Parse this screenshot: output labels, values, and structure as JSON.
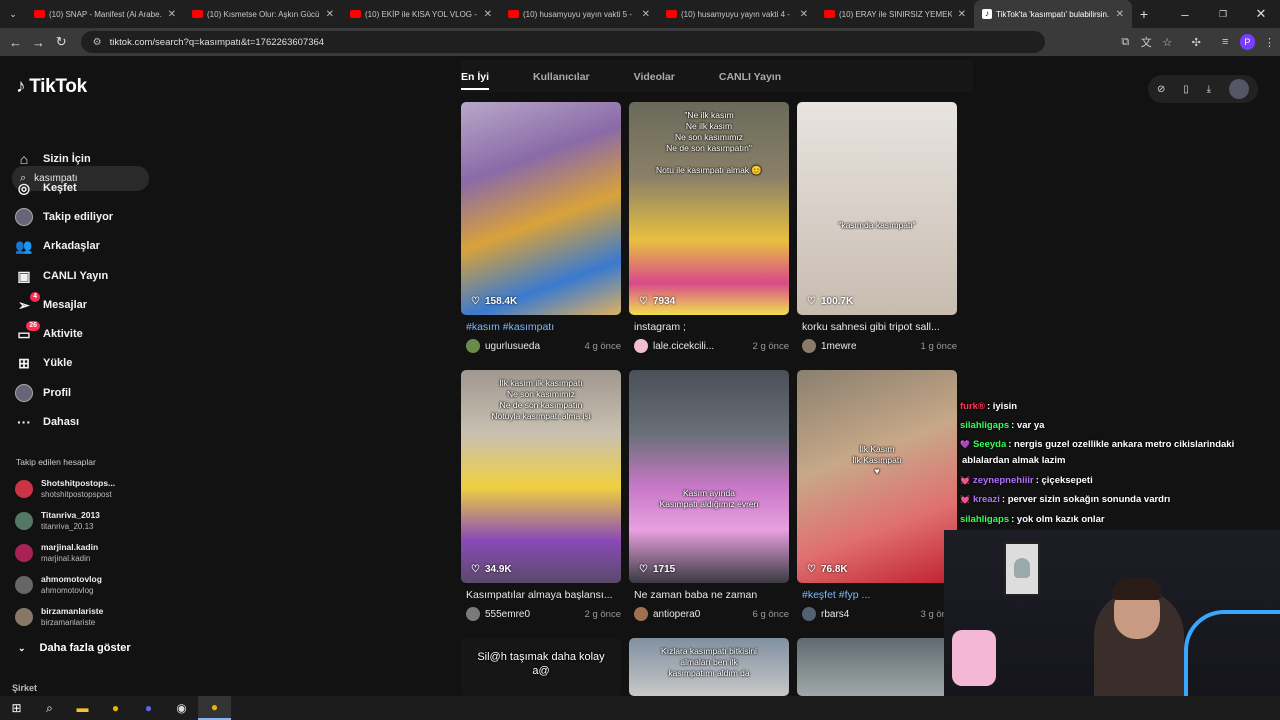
{
  "browser": {
    "tabs": [
      {
        "label": "(10) SNAP - Manifest (Ai Arabe...",
        "icon": "youtube-icon",
        "active": false
      },
      {
        "label": "(10) Kısmetse Olur: Aşkın Gücü...",
        "icon": "youtube-icon",
        "active": false
      },
      {
        "label": "(10) EKİP ile KISA YOL VLOG - T...",
        "icon": "youtube-icon",
        "active": false
      },
      {
        "label": "(10) husamyuyu yayın vakti 5 -",
        "icon": "youtube-icon",
        "active": false
      },
      {
        "label": "(10) husamyuyu yayın vakti 4 -",
        "icon": "youtube-icon",
        "active": false
      },
      {
        "label": "(10) ERAY ile SINIRSIZ YEMEK T...",
        "icon": "youtube-icon",
        "active": false
      },
      {
        "label": "TikTok'ta 'kasımpatı' bulabilirsin...",
        "icon": "tiktok-icon",
        "active": true
      }
    ],
    "new_tab": "+",
    "url": "tiktok.com/search?q=kasımpatı&t=1762263607364",
    "profile_initial": "P"
  },
  "sidebar": {
    "logo": "TikTok",
    "search_value": "kasımpatı",
    "menu": [
      {
        "label": "Sizin İçin",
        "icon": "home-icon",
        "glyph": "⌂"
      },
      {
        "label": "Keşfet",
        "icon": "compass-icon",
        "glyph": "◎"
      },
      {
        "label": "Takip ediliyor",
        "icon": "following-avatar-icon",
        "glyph": ""
      },
      {
        "label": "Arkadaşlar",
        "icon": "friends-icon",
        "glyph": "👥"
      },
      {
        "label": "CANLI Yayın",
        "icon": "live-icon",
        "glyph": "▣"
      },
      {
        "label": "Mesajlar",
        "icon": "messages-icon",
        "glyph": "➢",
        "badge": "4"
      },
      {
        "label": "Aktivite",
        "icon": "activity-icon",
        "glyph": "▭",
        "badge": "26"
      },
      {
        "label": "Yükle",
        "icon": "upload-icon",
        "glyph": "⊞"
      },
      {
        "label": "Profil",
        "icon": "profile-avatar-icon",
        "glyph": ""
      },
      {
        "label": "Dahası",
        "icon": "more-icon",
        "glyph": "···"
      }
    ],
    "followed_title": "Takip edilen hesaplar",
    "followed": [
      {
        "name": "Shotshitpostops...",
        "handle": "shotshitpostopspost",
        "color": "#cc3344"
      },
      {
        "name": "Titanriva_2013",
        "handle": "titanriva_20.13",
        "color": "#557766"
      },
      {
        "name": "marjinal.kadin",
        "handle": "marjinal.kadin",
        "color": "#aa2255"
      },
      {
        "name": "ahmomotovlog",
        "handle": "ahmomotovlog",
        "color": "#666666"
      },
      {
        "name": "birzamanlariste",
        "handle": "birzamanlariste",
        "color": "#887766"
      }
    ],
    "show_more": "Daha fazla göster",
    "company": "Şirket"
  },
  "search_tabs": [
    "En İyi",
    "Kullanıcılar",
    "Videolar",
    "CANLI Yayın"
  ],
  "results": [
    {
      "likes": "158.4K",
      "desc": "#kasım #kasımpatı",
      "desc_is_tag": true,
      "user": "ugurlusueda",
      "time": "4 g önce",
      "overlay": "",
      "bg": "linear-gradient(160deg,#b8a8c8 0%,#8a6aa8 30%,#d9a23a 55%,#3a7ad0 80%,#e0b060 100%)",
      "avatar": "#6a8a4a"
    },
    {
      "likes": "7934",
      "desc": "instagram ;",
      "desc_is_tag": false,
      "user": "lale.cicekcili...",
      "time": "2 g önce",
      "overlay": "\"Ne ilk kasım\nNe ilk kasım\nNe son kasımımız\nNe de son kasımpatın\"\n\nNotu ile kasımpatı almak 😊",
      "bg": "linear-gradient(180deg,#6a6a5a 0%,#8a8068 35%,#e8c040 65%,#d84a8a 85%,#f0e050 100%)",
      "avatar": "#f0c0d0"
    },
    {
      "likes": "100.7K",
      "desc": "korku sahnesi gibi tripot sall...",
      "desc_is_tag": false,
      "user": "1mewre",
      "time": "1 g önce",
      "overlay": "\n\n\n\n\n\n\n\n\n\n\"kasımda kasımpatı\"",
      "bg": "linear-gradient(180deg,#e8e4e0 0%,#d8d0c8 50%,#c8bcb0 100%)",
      "avatar": "#8a7a6a"
    },
    {
      "likes": "34.9K",
      "desc": "Kasımpatılar almaya başlansı...",
      "desc_is_tag": false,
      "user": "555emre0",
      "time": "2 g önce",
      "overlay": "İlk kasım ilk kasımpatı\nNe son kasımımız\nNe de son kasımpatın\nNotuyla kasımpatı alma işi",
      "bg": "linear-gradient(180deg,#a09890 0%,#c8c0b0 30%,#f0d040 55%,#8a4ab8 80%,#5a4a6a 100%)",
      "avatar": "#7a7a7a"
    },
    {
      "likes": "1715",
      "desc": "Ne zaman baba ne zaman",
      "desc_is_tag": false,
      "user": "antiopera0",
      "time": "6 g önce",
      "overlay": "\n\n\n\n\n\n\n\n\n\nKasım ayında\nKasımpatı aldığımız evren",
      "bg": "linear-gradient(180deg,#4a5058 0%,#6a7078 30%,#c878c8 55%,#e8a0e0 75%,#3a3a42 100%)",
      "avatar": "#a07050"
    },
    {
      "likes": "76.8K",
      "desc": "#keşfet #fyp ...",
      "desc_is_tag": true,
      "user": "rbars4",
      "time": "3 g önce",
      "overlay": "\n\n\n\n\n\nİlk Kasım\nİlk Kasımpatı\n♥",
      "bg": "linear-gradient(160deg,#8a8070 0%,#c8a888 40%,#e07070 70%,#c02030 100%)",
      "avatar": "#556070"
    },
    {
      "likes": "",
      "desc": "",
      "desc_is_tag": false,
      "user": "",
      "time": "",
      "overlay": "Sil@h taşımak daha kolay\na@",
      "bg": "#161616",
      "avatar": ""
    },
    {
      "likes": "",
      "desc": "",
      "desc_is_tag": false,
      "user": "",
      "time": "",
      "overlay": "Kızlara kasımpatı bitkisini\nalmaları ben ilk\nkasımpatımı aldım da",
      "bg": "linear-gradient(180deg,#8090a0 0%,#c8c8c8 100%)",
      "avatar": ""
    },
    {
      "likes": "",
      "desc": "",
      "desc_is_tag": false,
      "user": "",
      "time": "",
      "overlay": "",
      "bg": "linear-gradient(180deg,#606a70 0%,#a0a8a8 100%)",
      "avatar": ""
    }
  ],
  "chat": [
    {
      "user": "furk®",
      "color": "#ff3355",
      "msg": ": iyisin",
      "icon": ""
    },
    {
      "user": "silahligaps",
      "color": "#33ff55",
      "msg": ": var ya",
      "icon": ""
    },
    {
      "user": "Seeyda",
      "color": "#33ff55",
      "msg": ": nergis guzel ozellikle ankara metro cikislarindaki",
      "icon": "💜"
    },
    {
      "user": "",
      "color": "#ffffff",
      "msg": "ablalardan almak lazim",
      "icon": ""
    },
    {
      "user": "zeynepnehiiir",
      "color": "#b070ff",
      "msg": ": çiçeksepeti",
      "icon": "💓"
    },
    {
      "user": "kreazi",
      "color": "#b070ff",
      "msg": ": perver sizin sokağın sonunda vardrı",
      "icon": "💓"
    },
    {
      "user": "silahligaps",
      "color": "#33ff55",
      "msg": ": yok olm kazık onlar",
      "icon": ""
    }
  ],
  "tools": [
    "⊘",
    "▯",
    "⤓"
  ],
  "taskbar": [
    {
      "name": "windows-start-icon",
      "glyph": "⊞",
      "active": false,
      "color": "#ffffff"
    },
    {
      "name": "search-icon",
      "glyph": "⌕",
      "active": false,
      "color": "#ffffff"
    },
    {
      "name": "file-explorer-icon",
      "glyph": "▬",
      "active": false,
      "color": "#f2c230"
    },
    {
      "name": "chrome-icon",
      "glyph": "●",
      "active": false,
      "color": "#e8b400"
    },
    {
      "name": "discord-icon",
      "glyph": "●",
      "active": false,
      "color": "#5865f2"
    },
    {
      "name": "obs-icon",
      "glyph": "◉",
      "active": false,
      "color": "#dddddd"
    },
    {
      "name": "chrome-active-icon",
      "glyph": "●",
      "active": true,
      "color": "#e8b400"
    }
  ]
}
